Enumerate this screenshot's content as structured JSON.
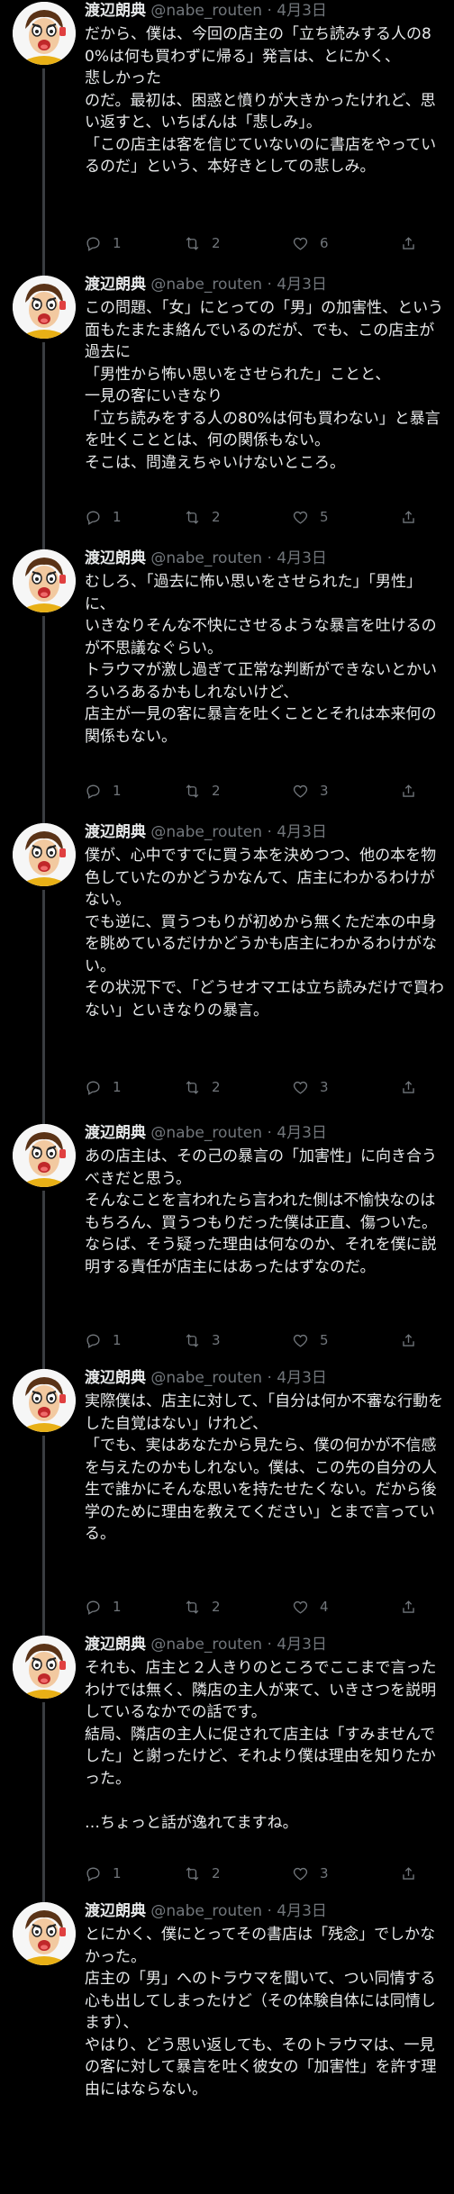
{
  "author": {
    "name": "渡辺朗典",
    "handle": "@nabe_routen",
    "separator": "·"
  },
  "tweets": [
    {
      "date": "4月3日",
      "text": "だから、僕は、今回の店主の「立ち読みする人の80%は何も買わずに帰る」発言は、とにかく、\n悲しかった\nのだ。最初は、困惑と憤りが大きかったけれど、思い返すと、いちばんは「悲しみ」。\n「この店主は客を信じていないのに書店をやっているのだ」という、本好きとしての悲しみ。",
      "replies": "1",
      "retweets": "2",
      "likes": "6"
    },
    {
      "date": "4月3日",
      "text": "この問題、「女」にとっての「男」の加害性、という面もたまたま絡んでいるのだが、でも、この店主が過去に\n「男性から怖い思いをさせられた」ことと、\n一見の客にいきなり\n「立ち読みをする人の80%は何も買わない」と暴言を吐くこととは、何の関係もない。\nそこは、問違えちゃいけないところ。",
      "replies": "1",
      "retweets": "2",
      "likes": "5"
    },
    {
      "date": "4月3日",
      "text": "むしろ、「過去に怖い思いをさせられた」「男性」に、\nいきなりそんな不快にさせるような暴言を吐けるのが不思議なぐらい。\nトラウマが激し過ぎて正常な判断ができないとかいろいろあるかもしれないけど、\n店主が一見の客に暴言を吐くこととそれは本来何の関係もない。",
      "replies": "1",
      "retweets": "2",
      "likes": "3"
    },
    {
      "date": "4月3日",
      "text": "僕が、心中ですでに買う本を決めつつ、他の本を物色していたのかどうかなんて、店主にわかるわけがない。\nでも逆に、買うつもりが初めから無くただ本の中身を眺めているだけかどうかも店主にわかるわけがない。\nその状況下で、「どうせオマエは立ち読みだけで買わない」といきなりの暴言。",
      "replies": "1",
      "retweets": "2",
      "likes": "3"
    },
    {
      "date": "4月3日",
      "text": "あの店主は、その己の暴言の「加害性」に向き合うべきだと思う。\nそんなことを言われたら言われた側は不愉快なのはもちろん、買うつもりだった僕は正直、傷ついた。\nならば、そう疑った理由は何なのか、それを僕に説明する責任が店主にはあったはずなのだ。",
      "replies": "1",
      "retweets": "3",
      "likes": "5"
    },
    {
      "date": "4月3日",
      "text": "実際僕は、店主に対して、「自分は何か不審な行動をした自覚はない」けれど、\n「でも、実はあなたから見たら、僕の何かが不信感を与えたのかもしれない。僕は、この先の自分の人生で誰かにそんな思いを持たせたくない。だから後学のために理由を教えてください」とまで言っている。",
      "replies": "1",
      "retweets": "2",
      "likes": "4"
    },
    {
      "date": "4月3日",
      "text": "それも、店主と２人きりのところでここまで言ったわけでは無く、隣店の主人が来て、いきさつを説明しているなかでの話です。\n結局、隣店の主人に促されて店主は「すみませんでした」と謝ったけど、それより僕は理由を知りたかった。\n\n…ちょっと話が逸れてますね。",
      "replies": "1",
      "retweets": "2",
      "likes": "3"
    },
    {
      "date": "4月3日",
      "text": "とにかく、僕にとってその書店は「残念」でしかなかった。\n店主の「男」へのトラウマを聞いて、つい同情する心も出してしまったけど（その体験自体には同情します）、\nやはり、どう思い返しても、そのトラウマは、一見の客に対して暴言を吐く彼女の「加害性」を許す理由にはならない。",
      "replies": "",
      "retweets": "",
      "likes": ""
    }
  ],
  "icons": {
    "reply": "reply-icon",
    "retweet": "retweet-icon",
    "like": "heart-icon",
    "share": "share-icon"
  }
}
